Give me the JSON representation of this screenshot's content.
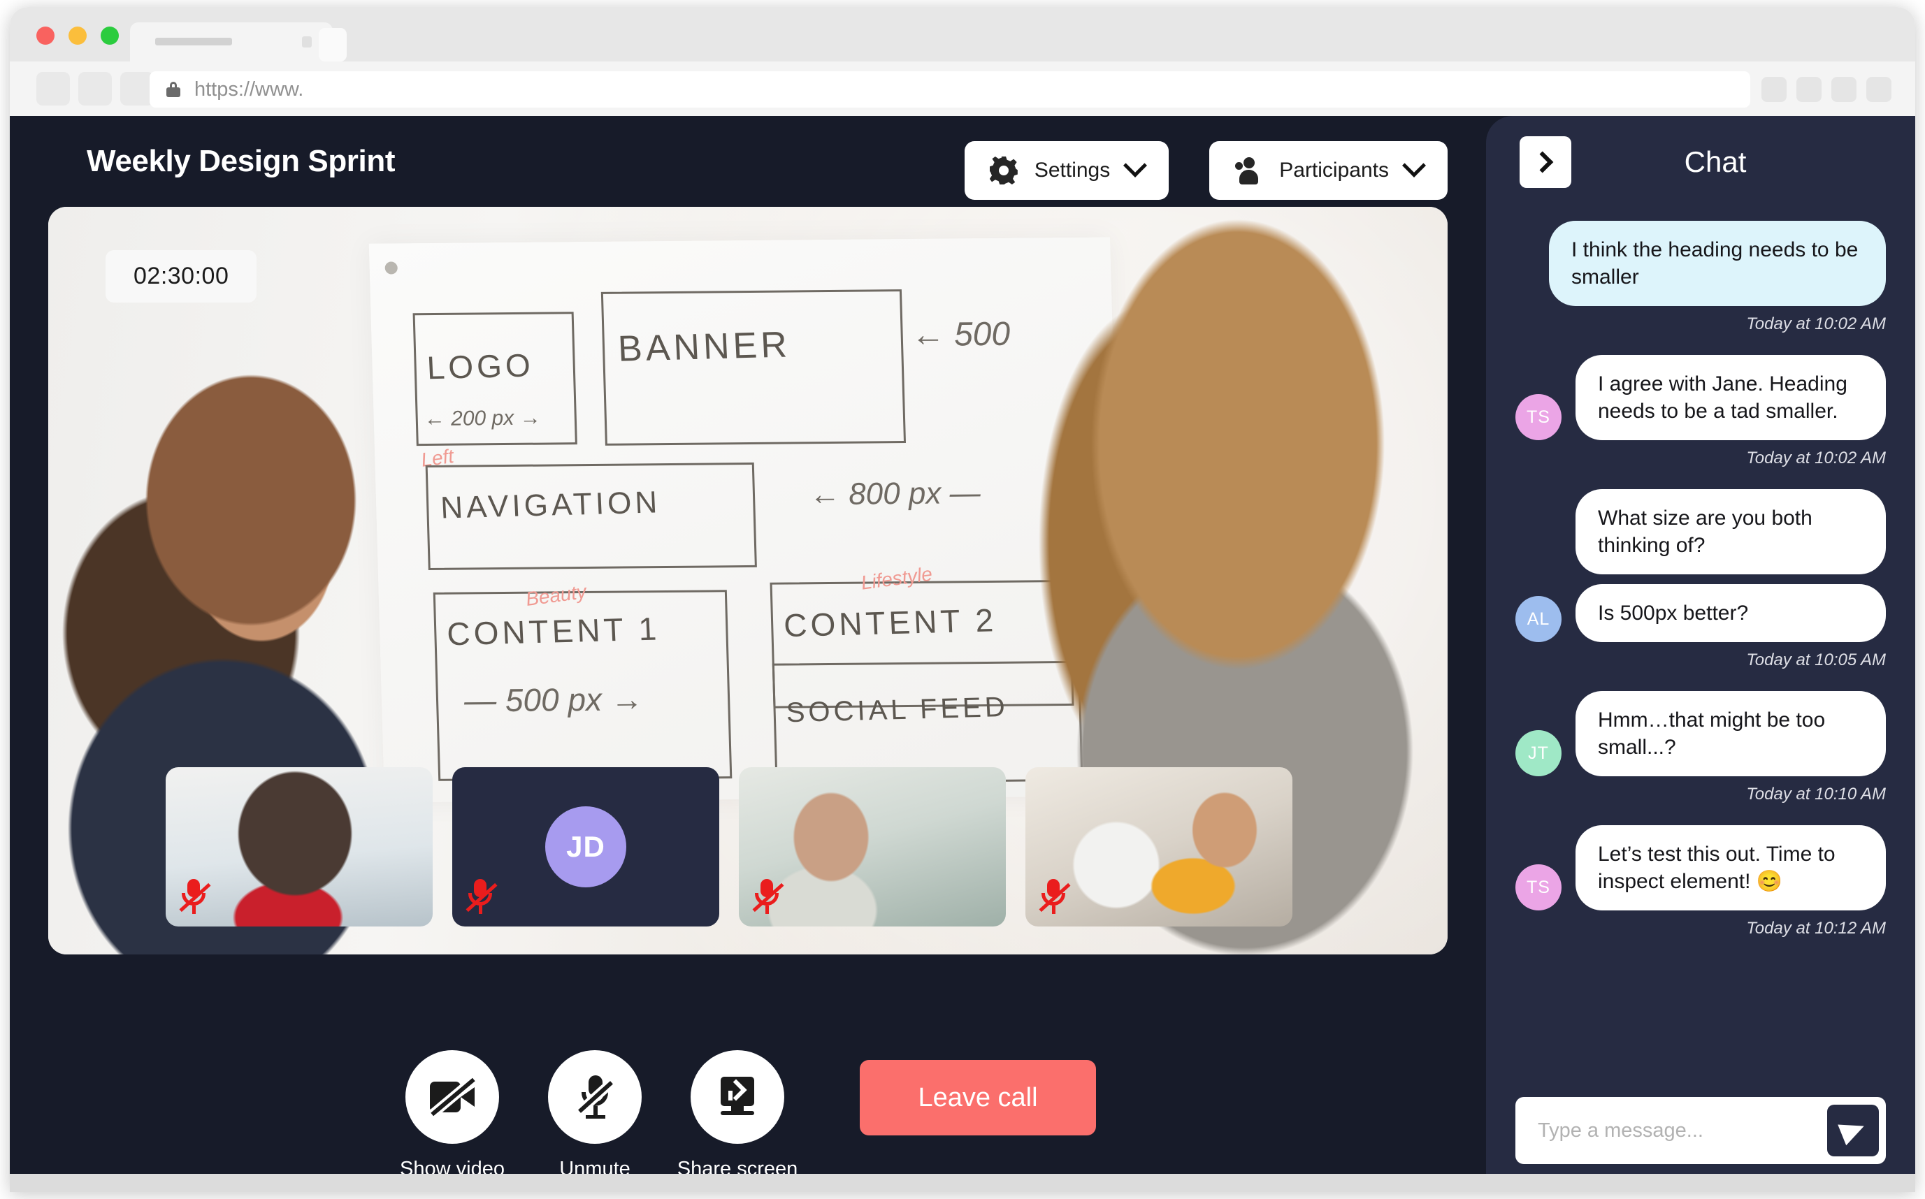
{
  "browser": {
    "url_text": "https://www.",
    "lock_icon": "lock-icon",
    "tab_placeholder": "",
    "nav_buttons": [
      "back-button",
      "forward-button",
      "reload-button"
    ],
    "extension_buttons": [
      "extension-1",
      "extension-2",
      "extension-3",
      "extension-4"
    ]
  },
  "app": {
    "meeting_title": "Weekly Design Sprint",
    "header_buttons": [
      {
        "id": "settings",
        "label": "Settings",
        "icon": "gear-icon",
        "chevron": "chevron-down-icon"
      },
      {
        "id": "participants",
        "label": "Participants",
        "icon": "people-icon",
        "chevron": "chevron-down-icon"
      }
    ],
    "stage": {
      "timer": "02:30:00",
      "whiteboard": {
        "logo_label": "LOGO",
        "logo_dim": "← 200 px →",
        "banner_label": "BANNER",
        "banner_dim": "← 500",
        "nav_label": "NAVIGATION",
        "nav_dim": "← 800 px —",
        "content1_label": "CONTENT 1",
        "content1_tag": "Beauty",
        "content1_dim": "— 500 px →",
        "content2_label": "CONTENT 2",
        "content2_tag": "Lifestyle",
        "social_label": "SOCIAL FEED",
        "left_tag": "Left"
      }
    },
    "thumbnails": [
      {
        "id": "thumb-1",
        "kind": "video",
        "muted": true,
        "mute_icon": "mic-muted-icon"
      },
      {
        "id": "thumb-2",
        "kind": "avatar",
        "initials": "JD",
        "avatar_color": "#a79bef",
        "muted": true,
        "mute_icon": "mic-muted-icon"
      },
      {
        "id": "thumb-3",
        "kind": "video",
        "muted": true,
        "mute_icon": "mic-muted-icon"
      },
      {
        "id": "thumb-4",
        "kind": "video",
        "muted": true,
        "mute_icon": "mic-muted-icon"
      }
    ],
    "controls": [
      {
        "id": "show-video",
        "label": "Show video",
        "icon": "video-off-icon"
      },
      {
        "id": "unmute",
        "label": "Unmute",
        "icon": "mic-off-icon"
      },
      {
        "id": "share-screen",
        "label": "Share screen",
        "icon": "screen-share-icon"
      }
    ],
    "leave_call_label": "Leave call",
    "leave_call_color": "#fb6f6c"
  },
  "chat": {
    "title": "Chat",
    "collapse_icon": "chevron-right-icon",
    "send_icon": "send-plane-icon",
    "input_placeholder": "Type a message...",
    "input_value": "",
    "groups": [
      {
        "align": "right",
        "avatar": null,
        "avatar_color": null,
        "self": true,
        "bubbles": [
          "I think the heading needs to be smaller"
        ],
        "time": "Today at 10:02 AM"
      },
      {
        "align": "left",
        "avatar": "TS",
        "avatar_color": "#eba5e6",
        "self": false,
        "bubbles": [
          "I agree with Jane. Heading needs to be a tad smaller."
        ],
        "time": "Today at 10:02 AM"
      },
      {
        "align": "left",
        "avatar": "AL",
        "avatar_color": "#9dbdee",
        "self": false,
        "bubbles": [
          "What size are you both thinking of?",
          "Is 500px better?"
        ],
        "time": "Today at 10:05 AM"
      },
      {
        "align": "left",
        "avatar": "JT",
        "avatar_color": "#9fe8c6",
        "self": false,
        "bubbles": [
          "Hmm…that might be too small...?"
        ],
        "time": "Today at 10:10 AM"
      },
      {
        "align": "left",
        "avatar": "TS",
        "avatar_color": "#eba5e6",
        "self": false,
        "bubbles": [
          "Let’s test this out. Time to inspect element! 😊"
        ],
        "time": "Today at 10:12 AM"
      }
    ]
  },
  "colors": {
    "app_background": "#171b29",
    "chat_background": "#262b42",
    "self_bubble": "#ddf4fb",
    "leave_call": "#fb6f6c"
  }
}
